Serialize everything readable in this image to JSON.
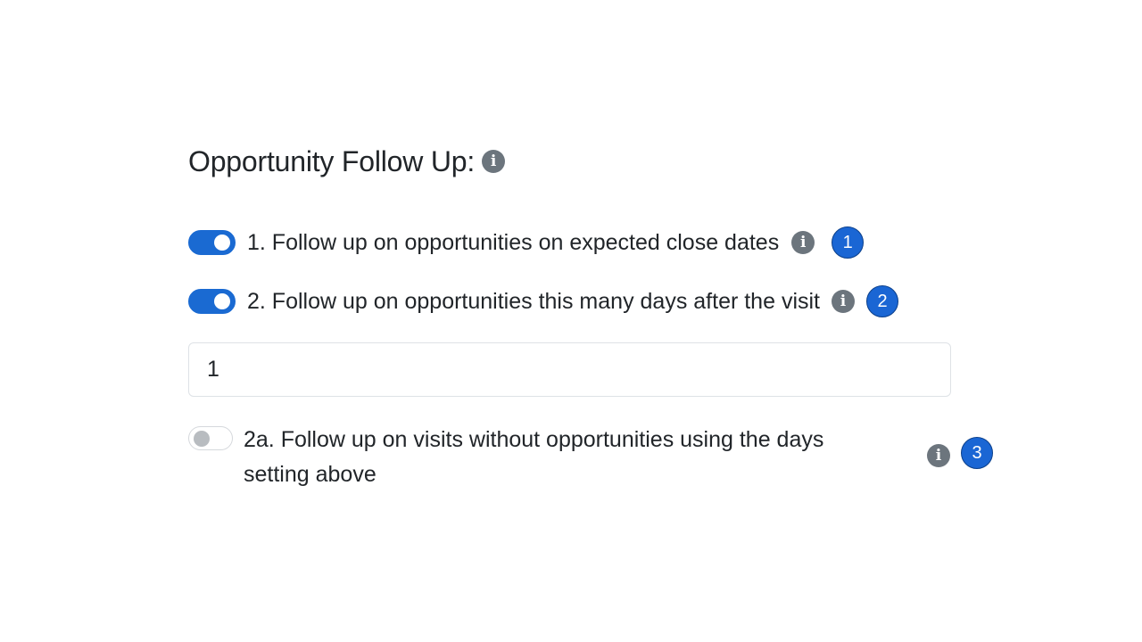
{
  "section": {
    "title": "Opportunity Follow Up:",
    "info_glyph": "i"
  },
  "options": [
    {
      "label": "1. Follow up on opportunities on expected close dates",
      "enabled": true,
      "callout": "1"
    },
    {
      "label": "2. Follow up on opportunities this many days after the visit",
      "enabled": true,
      "callout": "2"
    },
    {
      "label": "2a. Follow up on visits without opportunities using the days setting above",
      "enabled": false,
      "callout": "3"
    }
  ],
  "days_input": {
    "value": "1"
  },
  "colors": {
    "toggle_on": "#1a6ad2",
    "toggle_off_knob": "#b8bcc0",
    "info_icon": "#6c757d",
    "callout": "#1a66d4"
  },
  "icons": {
    "info": "info-circle-icon"
  }
}
